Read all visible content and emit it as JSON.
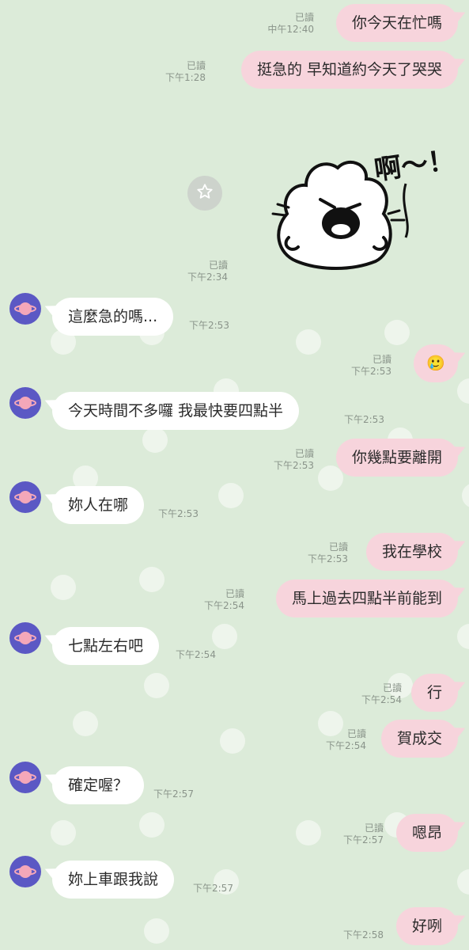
{
  "messages": [
    {
      "side": "out",
      "text": "你今天在忙嗎",
      "read": "已讀",
      "time": "中午12:40"
    },
    {
      "side": "out",
      "text": "挺急的 早知道約今天了哭哭",
      "read": "已讀",
      "time": "下午1:28"
    },
    {
      "side": "out",
      "type": "sticker",
      "sticker_text": "啊～！！",
      "read": "已讀",
      "time": "下午2:34"
    },
    {
      "side": "in",
      "text": "這麼急的嗎...",
      "time": "下午2:53"
    },
    {
      "side": "out",
      "text": "🥲",
      "read": "已讀",
      "time": "下午2:53"
    },
    {
      "side": "in",
      "text": "今天時間不多囉  我最快要四點半",
      "time": "下午2:53"
    },
    {
      "side": "out",
      "text": "你幾點要離開",
      "read": "已讀",
      "time": "下午2:53"
    },
    {
      "side": "in",
      "text": "妳人在哪",
      "time": "下午2:53"
    },
    {
      "side": "out",
      "text": "我在學校",
      "read": "已讀",
      "time": "下午2:53"
    },
    {
      "side": "out",
      "text": "馬上過去四點半前能到",
      "read": "已讀",
      "time": "下午2:54"
    },
    {
      "side": "in",
      "text": "七點左右吧",
      "time": "下午2:54"
    },
    {
      "side": "out",
      "text": "行",
      "read": "已讀",
      "time": "下午2:54"
    },
    {
      "side": "out",
      "text": "賀成交",
      "read": "已讀",
      "time": "下午2:54"
    },
    {
      "side": "in",
      "text": "確定喔？",
      "time": "下午2:57"
    },
    {
      "side": "out",
      "text": "嗯昂",
      "read": "已讀",
      "time": "下午2:57"
    },
    {
      "side": "in",
      "text": "妳上車跟我說",
      "time": "下午2:57"
    },
    {
      "side": "out",
      "text": "好咧",
      "time": "下午2:58"
    }
  ],
  "icons": {
    "avatar": "planet-avatar-icon",
    "favorite": "star-icon"
  },
  "colors": {
    "background": "#dcebd9",
    "outgoing": "#f7d4dc",
    "incoming": "#ffffff",
    "avatar": "#5b58c4"
  }
}
